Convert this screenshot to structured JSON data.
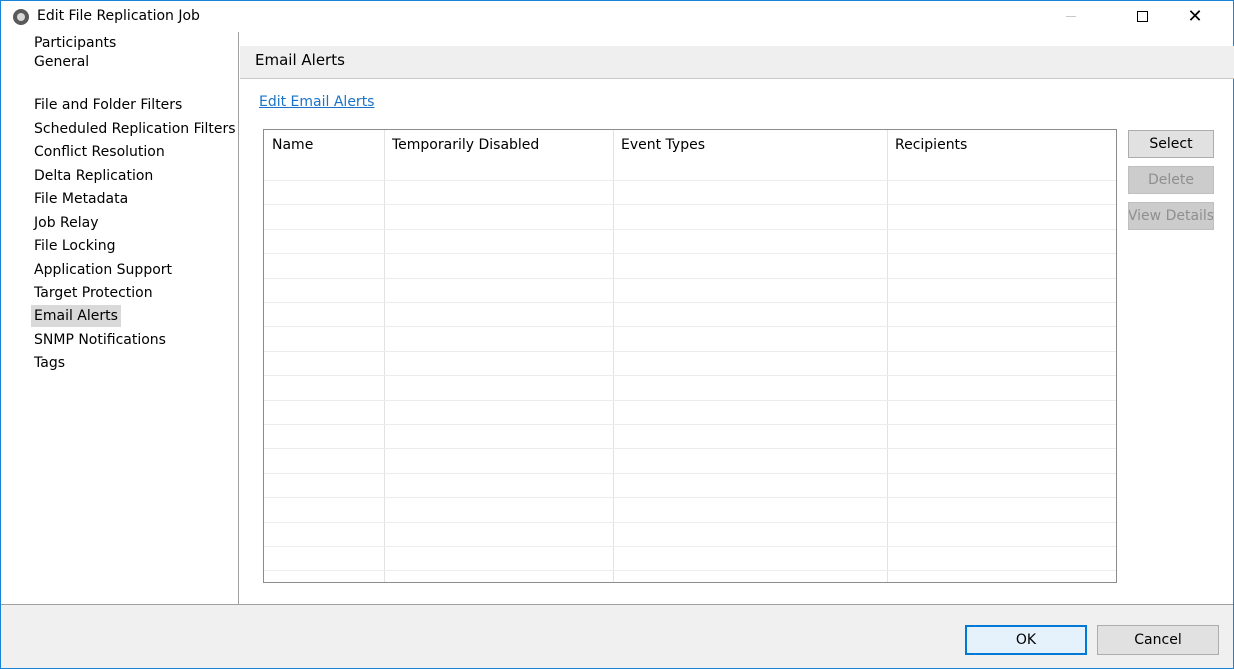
{
  "window": {
    "title": "Edit File Replication Job",
    "close_glyph": "✕"
  },
  "nav": {
    "items": [
      {
        "label": "Participants",
        "selected": false
      },
      {
        "label": "General",
        "selected": false
      },
      {
        "label": "File and Folder Filters",
        "selected": false
      },
      {
        "label": "Scheduled Replication Filters",
        "selected": false
      },
      {
        "label": "Conflict Resolution",
        "selected": false
      },
      {
        "label": "Delta Replication",
        "selected": false
      },
      {
        "label": "File Metadata",
        "selected": false
      },
      {
        "label": "Job Relay",
        "selected": false
      },
      {
        "label": "File Locking",
        "selected": false
      },
      {
        "label": "Application Support",
        "selected": false
      },
      {
        "label": "Target Protection",
        "selected": false
      },
      {
        "label": "Email Alerts",
        "selected": true
      },
      {
        "label": "SNMP Notifications",
        "selected": false
      },
      {
        "label": "Tags",
        "selected": false
      }
    ]
  },
  "main": {
    "section_title": "Email Alerts",
    "edit_link": "Edit Email Alerts",
    "table": {
      "columns": [
        "Name",
        "Temporarily Disabled",
        "Event Types",
        "Recipients"
      ],
      "rows": []
    },
    "buttons": {
      "select": "Select",
      "delete": "Delete",
      "view_details": "View Details"
    }
  },
  "footer": {
    "ok": "OK",
    "cancel": "Cancel"
  },
  "colors": {
    "link": "#1a73c8",
    "accent": "#0078d7",
    "selection": "#d9d9d9"
  }
}
